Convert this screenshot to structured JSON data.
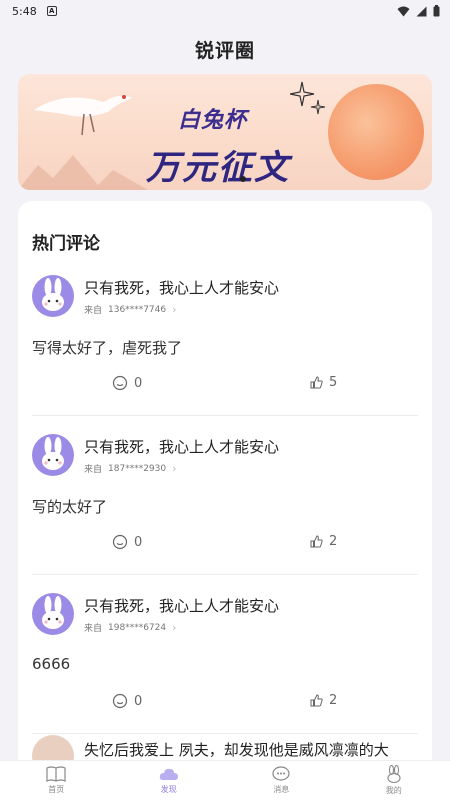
{
  "status": {
    "time": "5:48"
  },
  "header": {
    "title": "锐评圈"
  },
  "banner": {
    "line1": "白兔杯",
    "line2": "万元征文"
  },
  "section": {
    "title": "热门评论"
  },
  "comments": [
    {
      "title": "只有我死，我心上人才能安心",
      "from_label": "来自",
      "user": "136****7746",
      "body": "写得太好了，虐死我了",
      "comment_count": "0",
      "like_count": "5"
    },
    {
      "title": "只有我死，我心上人才能安心",
      "from_label": "来自",
      "user": "187****2930",
      "body": "写的太好了",
      "comment_count": "0",
      "like_count": "2"
    },
    {
      "title": "只有我死，我心上人才能安心",
      "from_label": "来自",
      "user": "198****6724",
      "body": "6666",
      "comment_count": "0",
      "like_count": "2"
    }
  ],
  "partial_comment": {
    "title": "失忆后我爱上 夙夫，却发现他是威风凛凛的大"
  },
  "tabs": [
    {
      "label": "首页",
      "icon": "book-icon"
    },
    {
      "label": "发现",
      "icon": "cloud-icon"
    },
    {
      "label": "消息",
      "icon": "chat-icon"
    },
    {
      "label": "我的",
      "icon": "rabbit-icon"
    }
  ],
  "colors": {
    "accent": "#8E7FE0",
    "avatar": "#9B8BE6",
    "background": "#F3F2F7"
  }
}
